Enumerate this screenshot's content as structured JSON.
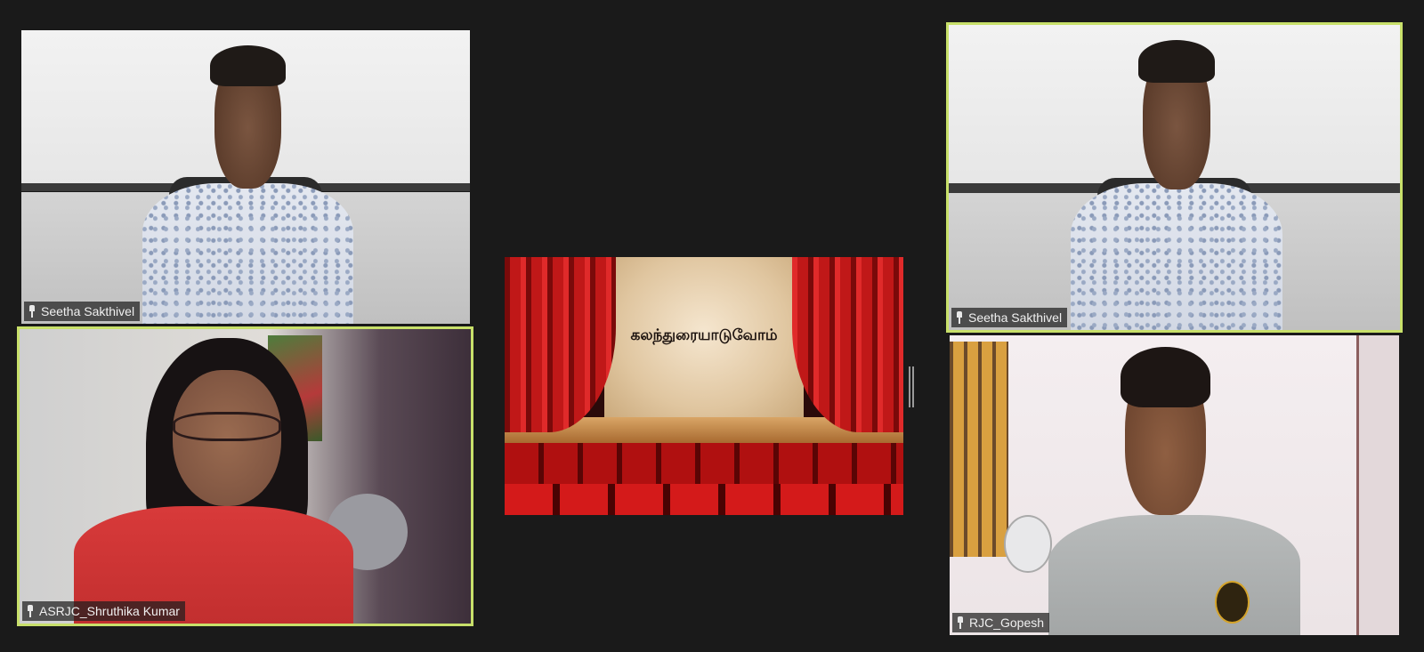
{
  "participants": [
    {
      "name": "Seetha Sakthivel",
      "speaking": false
    },
    {
      "name": "ASRJC_Shruthika Kumar",
      "speaking": true
    },
    {
      "name": "Seetha Sakthivel",
      "speaking": true
    },
    {
      "name": "RJC_Gopesh",
      "speaking": false
    }
  ],
  "screen_share": {
    "slide_text": "கலந்துரையாடுவோம்"
  },
  "colors": {
    "background": "#1a1a1a",
    "active_speaker_border": "#c8e06a",
    "label_bg": "#1e1e1e",
    "curtain_red": "#c01818"
  },
  "icons": {
    "pin": "pin-icon"
  }
}
